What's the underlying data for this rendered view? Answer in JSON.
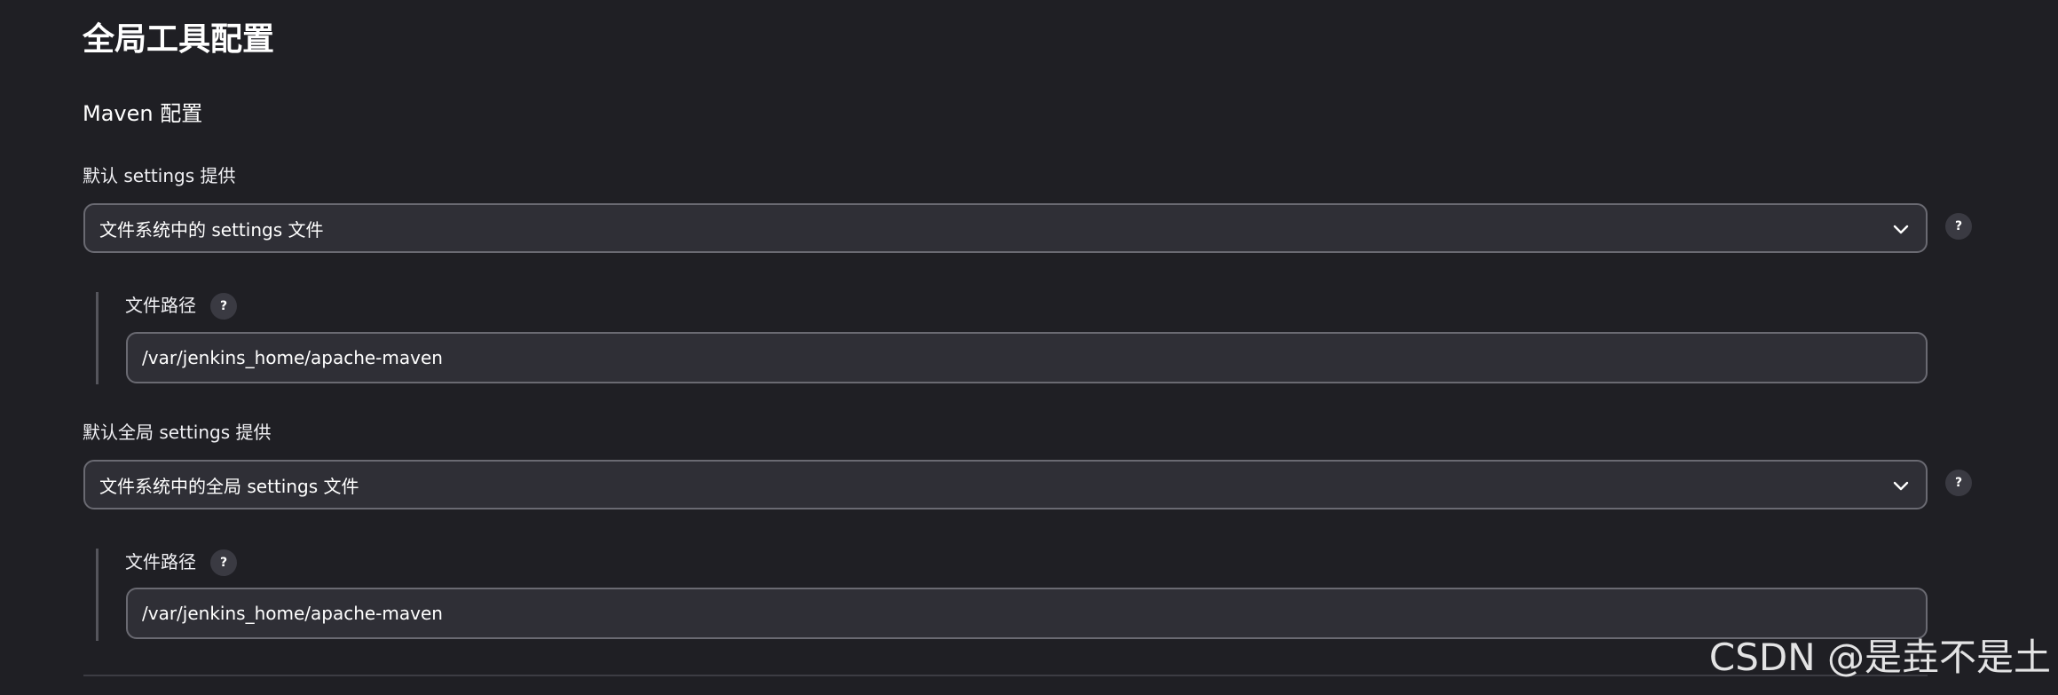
{
  "page": {
    "title": "全局工具配置",
    "section_title": "Maven 配置"
  },
  "settings": {
    "label": "默认 settings 提供",
    "selected": "文件系统中的 settings 文件",
    "help": "?",
    "path_label": "文件路径",
    "path_help": "?",
    "path_value": "/var/jenkins_home/apache-maven"
  },
  "global_settings": {
    "label": "默认全局 settings 提供",
    "selected": "文件系统中的全局 settings 文件",
    "help": "?",
    "path_label": "文件路径",
    "path_help": "?",
    "path_value": "/var/jenkins_home/apache-maven"
  },
  "watermark": "CSDN @是垚不是土",
  "colors": {
    "background": "#1f1f24",
    "input_background": "#2f2f36",
    "input_border": "#6a6a72",
    "help_background": "#3a3a42"
  },
  "icons": {
    "dropdown": "chevron-down-icon",
    "help": "question-mark-icon"
  }
}
